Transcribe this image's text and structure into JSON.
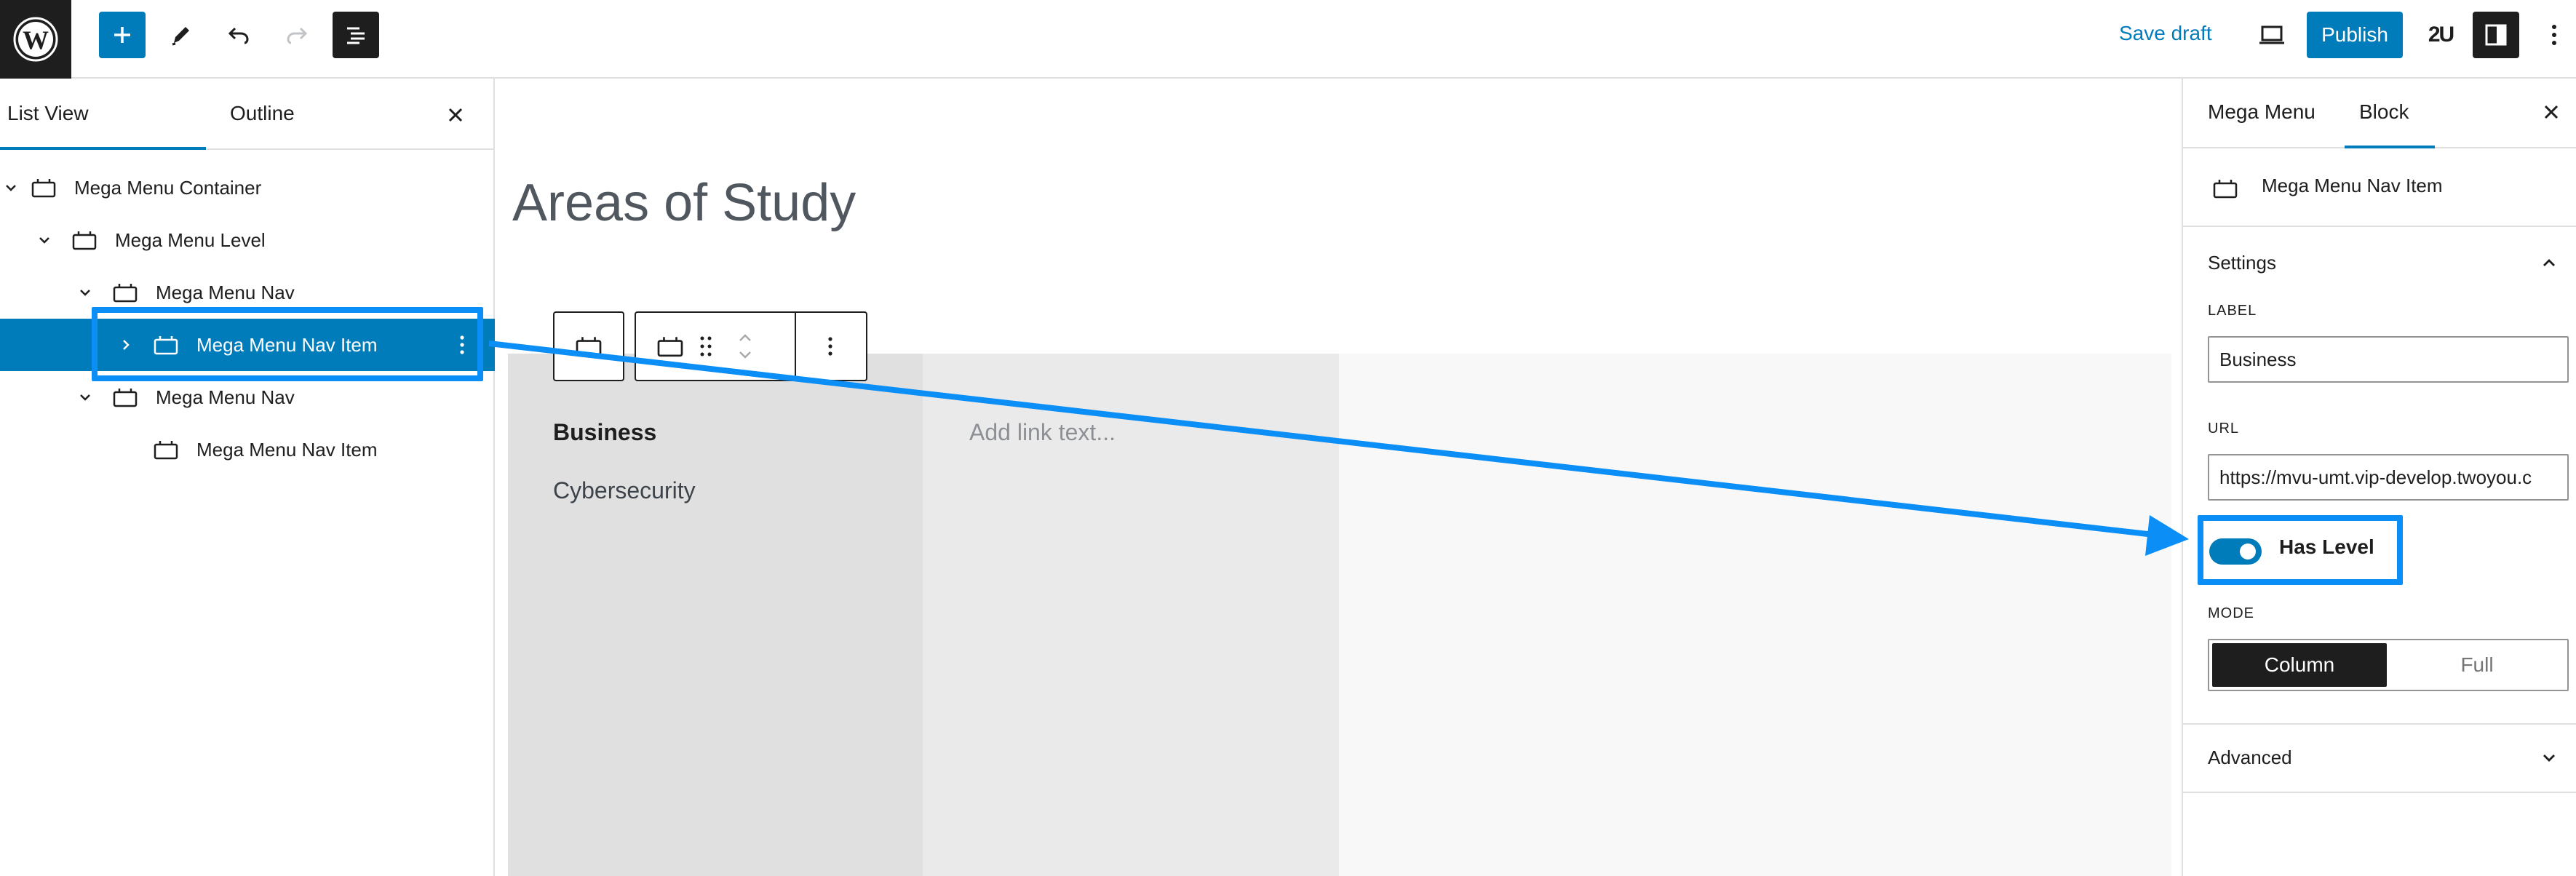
{
  "topbar": {
    "logo_icon": "wordpress-logo-icon",
    "save_draft_label": "Save draft",
    "publish_label": "Publish",
    "plugin_badge": "2U",
    "accent_color": "#007cba"
  },
  "list_view": {
    "tabs": [
      {
        "label": "List View"
      },
      {
        "label": "Outline"
      }
    ],
    "items": [
      {
        "label": "Mega Menu Container"
      },
      {
        "label": "Mega Menu Level"
      },
      {
        "label": "Mega Menu Nav"
      },
      {
        "label": "Mega Menu Nav Item",
        "selected": true
      },
      {
        "label": "Mega Menu Nav"
      },
      {
        "label": "Mega Menu Nav Item"
      }
    ]
  },
  "canvas": {
    "page_title": "Areas of Study",
    "column1_heading": "Business",
    "column1_link": "Cybersecurity",
    "column2_placeholder": "Add link text..."
  },
  "sidebar": {
    "tabs": [
      {
        "label": "Mega Menu"
      },
      {
        "label": "Block"
      }
    ],
    "block_name": "Mega Menu Nav Item",
    "settings_title": "Settings",
    "label_field": {
      "label": "LABEL",
      "value": "Business"
    },
    "url_field": {
      "label": "URL",
      "value": "https://mvu-umt.vip-develop.twoyou.c"
    },
    "has_level": {
      "label": "Has Level",
      "enabled": true
    },
    "mode": {
      "label": "MODE",
      "options": [
        "Column",
        "Full"
      ],
      "selected": "Column"
    },
    "advanced_title": "Advanced"
  },
  "annotation": {
    "color": "#0b8ef6"
  }
}
